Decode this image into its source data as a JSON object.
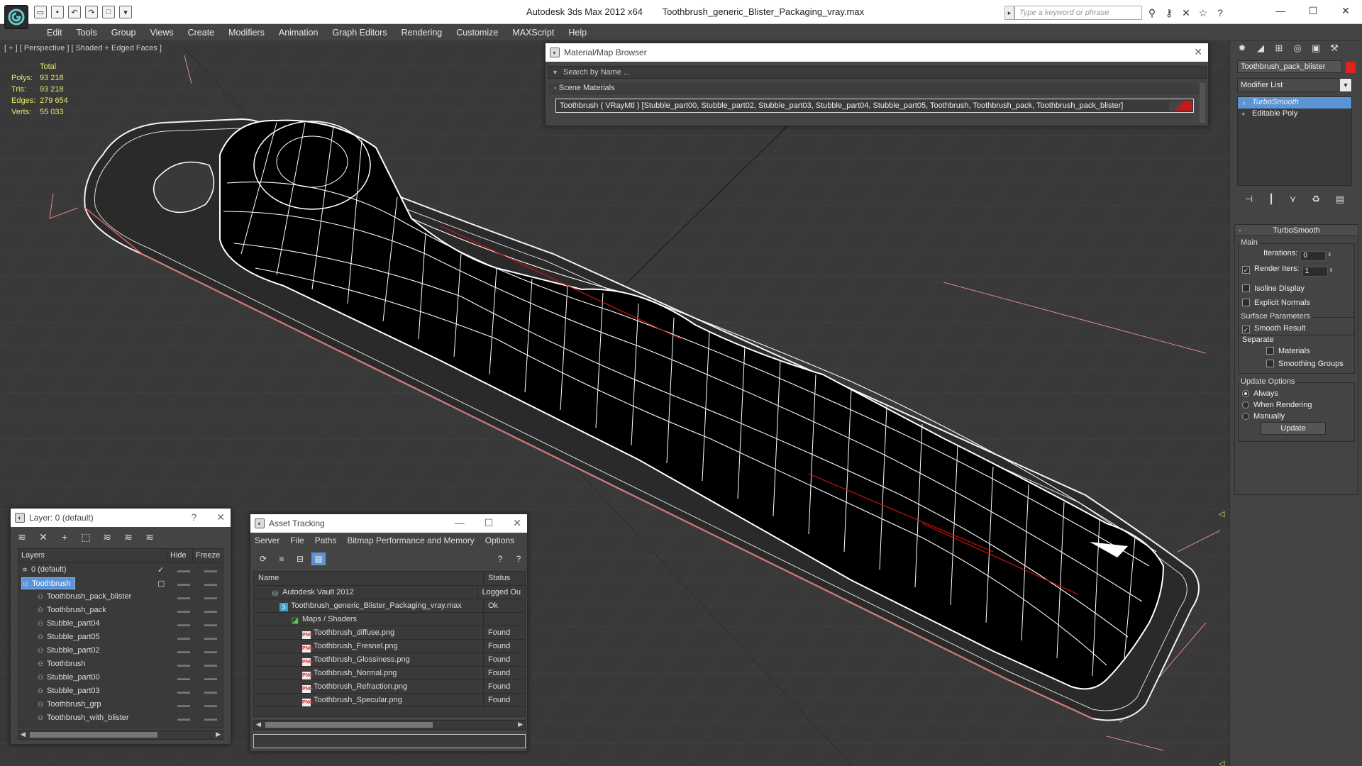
{
  "app": {
    "title": "Autodesk 3ds Max  2012 x64",
    "file": "Toothbrush_generic_Blister_Packaging_vray.max",
    "search_placeholder": "Type a keyword or phrase"
  },
  "menu": [
    "Edit",
    "Tools",
    "Group",
    "Views",
    "Create",
    "Modifiers",
    "Animation",
    "Graph Editors",
    "Rendering",
    "Customize",
    "MAXScript",
    "Help"
  ],
  "viewport": {
    "label": "[ + ] [ Perspective ] [ Shaded + Edged Faces ]",
    "stats": {
      "header": "Total",
      "rows": [
        {
          "label": "Polys:",
          "value": "93 218"
        },
        {
          "label": "Tris:",
          "value": "93 218"
        },
        {
          "label": "Edges:",
          "value": "279 654"
        },
        {
          "label": "Verts:",
          "value": "55 033"
        }
      ]
    }
  },
  "material_browser": {
    "title": "Material/Map Browser",
    "search": "Search by Name ...",
    "section": "Scene Materials",
    "material": "Toothbrush  ( VRayMtl ) [Stubble_part00, Stubble_part02, Stubble_part03, Stubble_part04, Stubble_part05, Toothbrush, Toothbrush_pack, Toothbrush_pack_blister]"
  },
  "command_panel": {
    "object_name": "Toothbrush_pack_blister",
    "modifier_list": "Modifier List",
    "stack": [
      "TurboSmooth",
      "Editable Poly"
    ],
    "rollout": {
      "title": "TurboSmooth",
      "main_label": "Main",
      "iterations_label": "Iterations:",
      "iterations_value": "0",
      "render_iters_label": "Render Iters:",
      "render_iters_value": "1",
      "isoline": "Isoline Display",
      "explicit_normals": "Explicit Normals",
      "surface_label": "Surface Parameters",
      "smooth_result": "Smooth Result",
      "separate": "Separate",
      "materials": "Materials",
      "smoothing_groups": "Smoothing Groups",
      "update_options": "Update Options",
      "always": "Always",
      "when_rendering": "When Rendering",
      "manually": "Manually",
      "update_button": "Update"
    }
  },
  "layer_panel": {
    "title": "Layer: 0 (default)",
    "help": "?",
    "columns": [
      "Layers",
      "Hide",
      "Freeze"
    ],
    "rows": [
      {
        "name": "0 (default)",
        "indent": 1
      },
      {
        "name": "Toothbrush",
        "indent": 1
      },
      {
        "name": "Toothbrush_pack_blister",
        "indent": 2
      },
      {
        "name": "Toothbrush_pack",
        "indent": 2
      },
      {
        "name": "Stubble_part04",
        "indent": 2
      },
      {
        "name": "Stubble_part05",
        "indent": 2
      },
      {
        "name": "Stubble_part02",
        "indent": 2
      },
      {
        "name": "Toothbrush",
        "indent": 2
      },
      {
        "name": "Stubble_part00",
        "indent": 2
      },
      {
        "name": "Stubble_part03",
        "indent": 2
      },
      {
        "name": "Toothbrush_grp",
        "indent": 2
      },
      {
        "name": "Toothbrush_with_blister",
        "indent": 2
      }
    ]
  },
  "asset_tracking": {
    "title": "Asset Tracking",
    "menu": [
      "Server",
      "File",
      "Paths",
      "Bitmap Performance and Memory",
      "Options"
    ],
    "columns": [
      "Name",
      "Status"
    ],
    "rows": [
      {
        "name": "Autodesk Vault 2012",
        "status": "Logged Ou",
        "icon": "vault",
        "indent": 24
      },
      {
        "name": "Toothbrush_generic_Blister_Packaging_vray.max",
        "status": "Ok",
        "icon": "max",
        "indent": 36
      },
      {
        "name": "Maps / Shaders",
        "status": "",
        "icon": "maps",
        "indent": 52
      },
      {
        "name": "Toothbrush_diffuse.png",
        "status": "Found",
        "icon": "png",
        "indent": 68
      },
      {
        "name": "Toothbrush_Fresnel.png",
        "status": "Found",
        "icon": "png",
        "indent": 68
      },
      {
        "name": "Toothbrush_Glossiness.png",
        "status": "Found",
        "icon": "png",
        "indent": 68
      },
      {
        "name": "Toothbrush_Normal.png",
        "status": "Found",
        "icon": "png",
        "indent": 68
      },
      {
        "name": "Toothbrush_Refraction.png",
        "status": "Found",
        "icon": "png",
        "indent": 68
      },
      {
        "name": "Toothbrush_Specular.png",
        "status": "Found",
        "icon": "png",
        "indent": 68
      }
    ]
  }
}
